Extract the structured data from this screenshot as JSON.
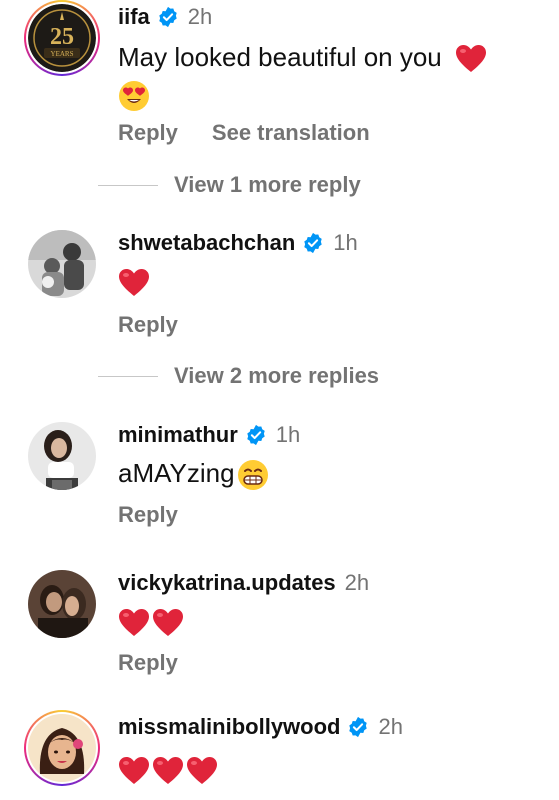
{
  "comments": [
    {
      "username": "iifa",
      "verified": true,
      "time": "2h",
      "text": "May looked beautiful on you",
      "text_emojis": [
        "red-heart",
        "heart-eyes-face"
      ],
      "actions": [
        "Reply",
        "See translation"
      ],
      "avatar_text": "25",
      "avatar_subtext": "YEARS"
    },
    {
      "username": "shwetabachchan",
      "verified": true,
      "time": "1h",
      "text": "",
      "text_emojis": [
        "red-heart"
      ],
      "actions": [
        "Reply"
      ]
    },
    {
      "username": "minimathur",
      "verified": true,
      "time": "1h",
      "text": "aMAYzing",
      "text_emojis": [
        "grinning-face"
      ],
      "actions": [
        "Reply"
      ]
    },
    {
      "username": "vickykatrina.updates",
      "verified": false,
      "time": "2h",
      "text": "",
      "text_emojis": [
        "red-heart",
        "red-heart"
      ],
      "actions": [
        "Reply"
      ]
    },
    {
      "username": "missmalinibollywood",
      "verified": true,
      "time": "2h",
      "text": "",
      "text_emojis": [
        "red-heart",
        "red-heart",
        "red-heart"
      ],
      "actions": []
    }
  ],
  "view_more": [
    "View 1 more reply",
    "View 2 more replies"
  ],
  "colors": {
    "verified_badge": "#0095f6",
    "secondary_text": "#737373",
    "heart": "#e0243a"
  }
}
